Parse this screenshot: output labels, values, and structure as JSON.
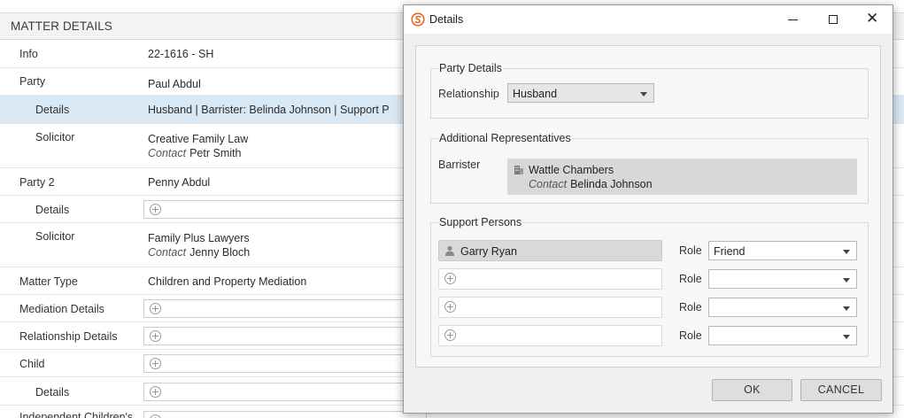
{
  "matter": {
    "header": "MATTER DETAILS",
    "rows": [
      {
        "label": "Info",
        "value": "22-1616 - SH"
      },
      {
        "label": "Party",
        "value": "Paul Abdul"
      },
      {
        "label": "Details",
        "value": "Husband  |  Barrister: Belinda Johnson  |  Support P"
      },
      {
        "label": "Solicitor",
        "firm": "Creative Family Law",
        "contact_label": "Contact",
        "contact_name": "Petr Smith"
      },
      {
        "label": "Party 2",
        "value": "Penny Abdul"
      },
      {
        "label": "Details"
      },
      {
        "label": "Solicitor",
        "firm": "Family Plus Lawyers",
        "contact_label": "Contact",
        "contact_name": "Jenny Bloch"
      },
      {
        "label": "Matter Type",
        "value": "Children and Property Mediation"
      },
      {
        "label": "Mediation Details"
      },
      {
        "label": "Relationship Details"
      },
      {
        "label": "Child"
      },
      {
        "label": "Details"
      },
      {
        "label": "Independent Children's"
      }
    ]
  },
  "dialog": {
    "title": "Details",
    "party_details": {
      "title": "Party Details",
      "relationship_label": "Relationship",
      "relationship_value": "Husband"
    },
    "additional_reps": {
      "title": "Additional Representatives",
      "barrister_label": "Barrister",
      "barrister_firm": "Wattle Chambers",
      "contact_label": "Contact",
      "contact_name": "Belinda Johnson"
    },
    "support_persons": {
      "title": "Support Persons",
      "role_label": "Role",
      "persons": [
        {
          "name": "Garry Ryan",
          "role": "Friend"
        },
        {
          "name": "",
          "role": ""
        },
        {
          "name": "",
          "role": ""
        },
        {
          "name": "",
          "role": ""
        }
      ]
    },
    "ok_label": "OK",
    "cancel_label": "CANCEL"
  },
  "colors": {
    "selected_row": "#d9e8f5",
    "dialog_bg": "#f0f0f0",
    "accent_icon": "#e8662a"
  }
}
